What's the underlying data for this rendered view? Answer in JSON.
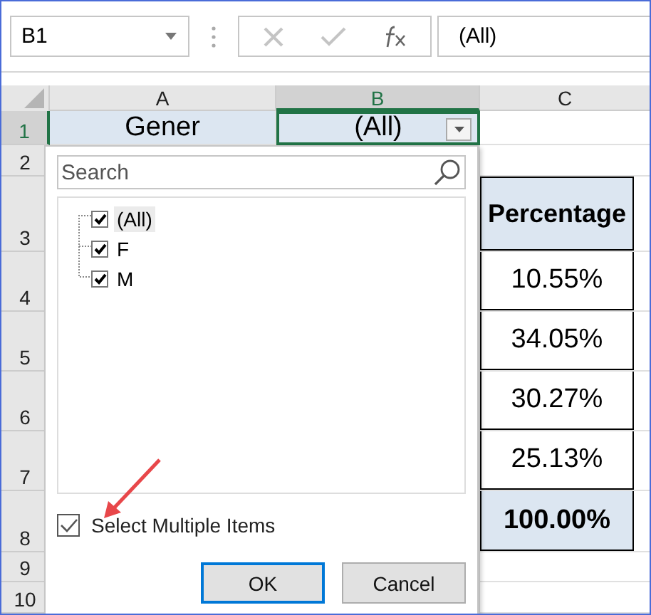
{
  "name_box": {
    "value": "B1"
  },
  "formula_bar": {
    "value": "(All)"
  },
  "columns": [
    {
      "label": "A",
      "selected": false
    },
    {
      "label": "B",
      "selected": true
    },
    {
      "label": "C",
      "selected": false
    }
  ],
  "rows": [
    {
      "number": "1",
      "selected": true,
      "a": "Gener",
      "b": "(All)",
      "b_filter": true
    },
    {
      "number": "2",
      "selected": false
    },
    {
      "number": "3",
      "selected": false,
      "c": "Percentage",
      "kind": "header"
    },
    {
      "number": "4",
      "selected": false,
      "c": "10.55%",
      "kind": "value"
    },
    {
      "number": "5",
      "selected": false,
      "c": "34.05%",
      "kind": "value"
    },
    {
      "number": "6",
      "selected": false,
      "c": "30.27%",
      "kind": "value"
    },
    {
      "number": "7",
      "selected": false,
      "c": "25.13%",
      "kind": "value"
    },
    {
      "number": "8",
      "selected": false,
      "c": "100.00%",
      "kind": "total"
    },
    {
      "number": "9",
      "selected": false
    },
    {
      "number": "10",
      "selected": false
    }
  ],
  "filter_panel": {
    "search": {
      "placeholder": "Search"
    },
    "items": [
      {
        "label": "(All)",
        "checked": true,
        "selected": true
      },
      {
        "label": "F",
        "checked": true,
        "selected": false
      },
      {
        "label": "M",
        "checked": true,
        "selected": false
      }
    ],
    "select_multiple": {
      "label": "Select Multiple Items",
      "checked": true
    },
    "buttons": [
      {
        "label": "OK",
        "default": true
      },
      {
        "label": "Cancel",
        "default": false
      }
    ]
  }
}
